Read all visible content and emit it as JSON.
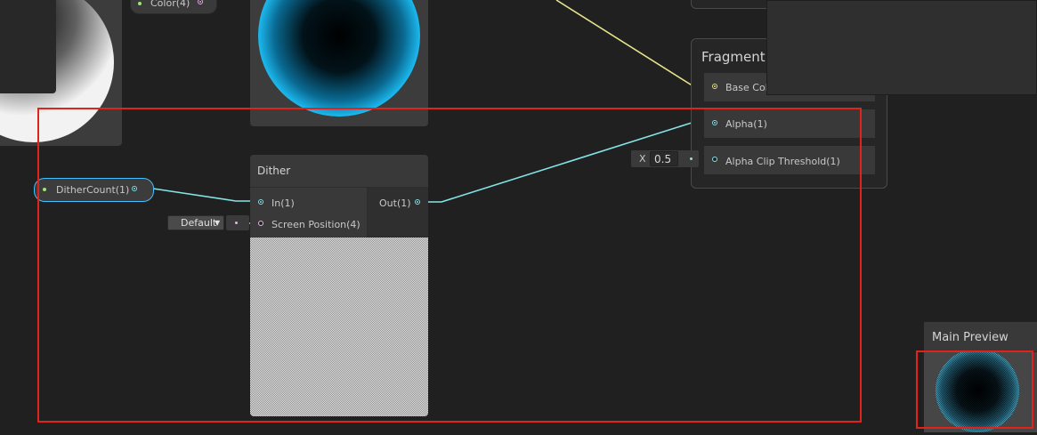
{
  "top_nodes": {
    "color_property_label": "Color(4)"
  },
  "dither_node": {
    "title": "Dither",
    "input_in": "In(1)",
    "input_screen_position": "Screen Position(4)",
    "output_out": "Out(1)",
    "screen_position_default": "Default"
  },
  "dither_count_property": {
    "label": "DitherCount(1)"
  },
  "fragment_block": {
    "title": "Fragment",
    "base_color_label": "Base Col",
    "alpha_label": "Alpha(1)",
    "alpha_clip_label": "Alpha Clip Threshold(1)",
    "alpha_clip_axis": "X",
    "alpha_clip_value": "0.5"
  },
  "main_preview": {
    "title": "Main Preview"
  },
  "colors": {
    "background": "#202020",
    "node_body": "#393939",
    "wire_cyan": "#84e4e7",
    "wire_yellow": "#e7e38b",
    "wire_pink": "#e7b4e6",
    "highlight_red": "#e1241b",
    "selection_blue": "#44c0ff"
  }
}
